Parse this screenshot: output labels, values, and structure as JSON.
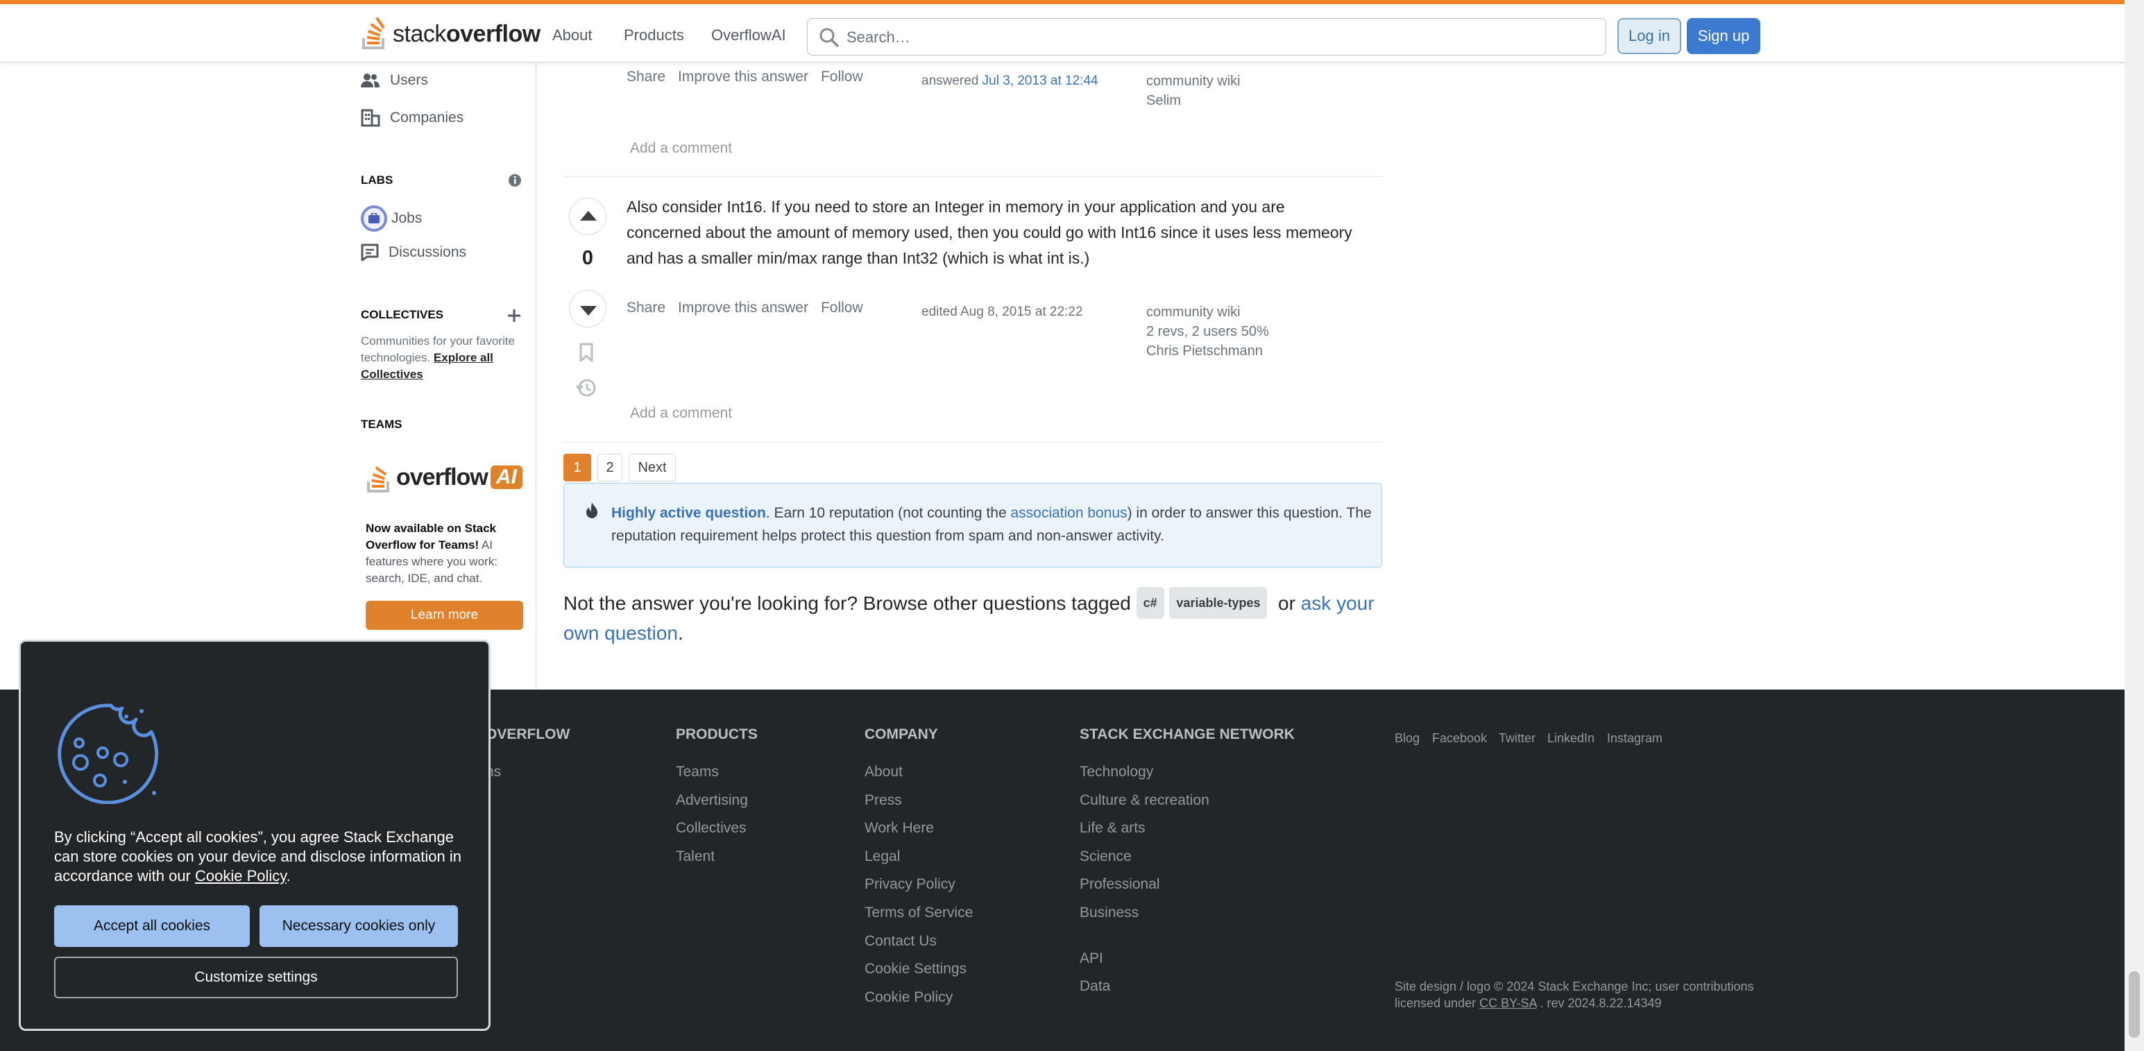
{
  "header": {
    "logo_text_light": "stack",
    "logo_text_bold": "overflow",
    "nav": [
      "About",
      "Products",
      "OverflowAI"
    ],
    "search_placeholder": "Search…",
    "login": "Log in",
    "signup": "Sign up"
  },
  "sidebar": {
    "users": "Users",
    "companies": "Companies",
    "labs_heading": "LABS",
    "jobs": "Jobs",
    "discussions": "Discussions",
    "collectives_heading": "COLLECTIVES",
    "collectives_text": "Communities for your favorite technologies.",
    "collectives_link": "Explore all Collectives",
    "teams_heading": "TEAMS",
    "overflowai_word": "overflow",
    "overflowai_badge": "AI",
    "ai_promo_bold": "Now available on Stack Overflow for Teams!",
    "ai_promo_text": " AI features where you work: search, IDE, and chat.",
    "learn_more": "Learn more"
  },
  "answer1": {
    "actions": [
      "Share",
      "Improve this answer",
      "Follow"
    ],
    "answered_prefix": "answered ",
    "answered_date": "Jul 3, 2013 at 12:44",
    "wiki": "community wiki",
    "author": "Selim",
    "add_comment": "Add a comment"
  },
  "answer2": {
    "body": "Also consider Int16. If you need to store an Integer in memory in your application and you are concerned about the amount of memory used, then you could go with Int16 since it uses less memeory and has a smaller min/max range than Int32 (which is what int is.)",
    "votes": "0",
    "actions": [
      "Share",
      "Improve this answer",
      "Follow"
    ],
    "edited": "edited Aug 8, 2015 at 22:22",
    "wiki": "community wiki",
    "revs": "2 revs, 2 users 50%",
    "author": "Chris Pietschmann",
    "add_comment": "Add a comment"
  },
  "pagination": [
    "1",
    "2",
    "Next"
  ],
  "notice": {
    "bold": "Highly active question",
    "text1": ". Earn 10 reputation (not counting the ",
    "link": "association bonus",
    "text2": ") in order to answer this question. The reputation requirement helps protect this question from spam and non-answer activity."
  },
  "browse": {
    "text": "Not the answer you're looking for? Browse other questions tagged",
    "tags": [
      "c#",
      "variable-types"
    ],
    "or": "or",
    "link": "ask your own question",
    "end": "."
  },
  "footer": {
    "col1_head_partial": "OVERFLOW",
    "col1_item_partial": "ns",
    "products_head": "PRODUCTS",
    "products": [
      "Teams",
      "Advertising",
      "Collectives",
      "Talent"
    ],
    "company_head": "COMPANY",
    "company": [
      "About",
      "Press",
      "Work Here",
      "Legal",
      "Privacy Policy",
      "Terms of Service",
      "Contact Us",
      "Cookie Settings",
      "Cookie Policy"
    ],
    "network_head": "STACK EXCHANGE NETWORK",
    "network": [
      "Technology",
      "Culture & recreation",
      "Life & arts",
      "Science",
      "Professional",
      "Business"
    ],
    "network_extra": [
      "API",
      "Data"
    ],
    "social": [
      "Blog",
      "Facebook",
      "Twitter",
      "LinkedIn",
      "Instagram"
    ],
    "copyright_line1": "Site design / logo © 2024 Stack Exchange Inc; user contributions",
    "copyright_line2_pre": "licensed under ",
    "license": "CC BY-SA",
    "copyright_line2_post": " . rev 2024.8.22.14349"
  },
  "cookie": {
    "text_pre": "By clicking “Accept all cookies”, you agree Stack Exchange can store cookies on your device and disclose information in accordance with our ",
    "policy_link": "Cookie Policy",
    "text_post": ".",
    "accept": "Accept all cookies",
    "necessary": "Necessary cookies only",
    "customize": "Customize settings"
  },
  "colors": {
    "accent_orange": "#f48225",
    "link_blue": "#3b6fb6",
    "footer_bg": "#232629"
  }
}
